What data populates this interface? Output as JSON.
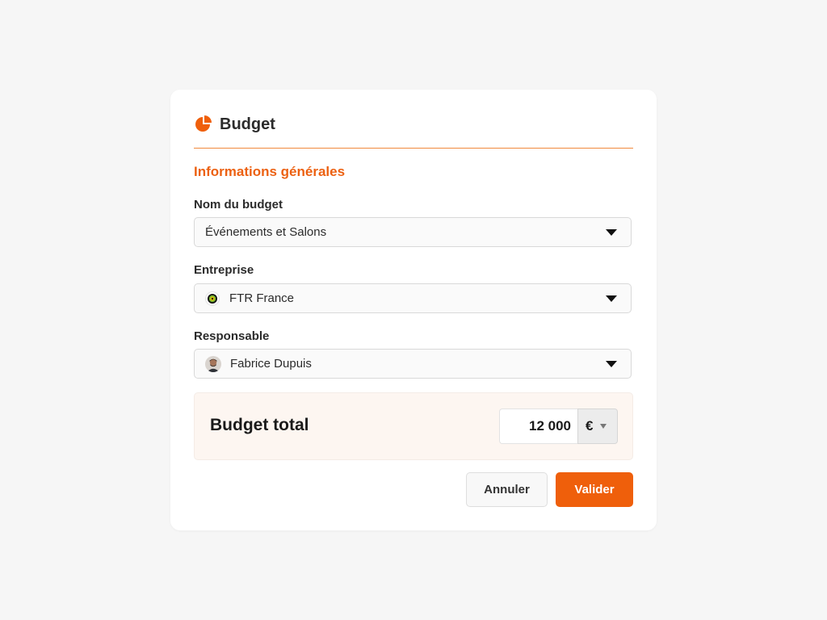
{
  "colors": {
    "accent": "#ec6112",
    "button_primary": "#ef5f0b",
    "total_bg": "#fdf6f1"
  },
  "header": {
    "icon": "pie-chart-icon",
    "title": "Budget"
  },
  "section": {
    "title": "Informations générales"
  },
  "fields": {
    "budget_name": {
      "label": "Nom du budget",
      "value": "Événements et Salons"
    },
    "company": {
      "label": "Entreprise",
      "icon": "company-logo-icon",
      "value": "FTR France"
    },
    "owner": {
      "label": "Responsable",
      "icon": "avatar",
      "value": "Fabrice Dupuis"
    }
  },
  "total": {
    "label": "Budget total",
    "amount": "12 000",
    "currency": "€"
  },
  "actions": {
    "cancel": "Annuler",
    "submit": "Valider"
  }
}
